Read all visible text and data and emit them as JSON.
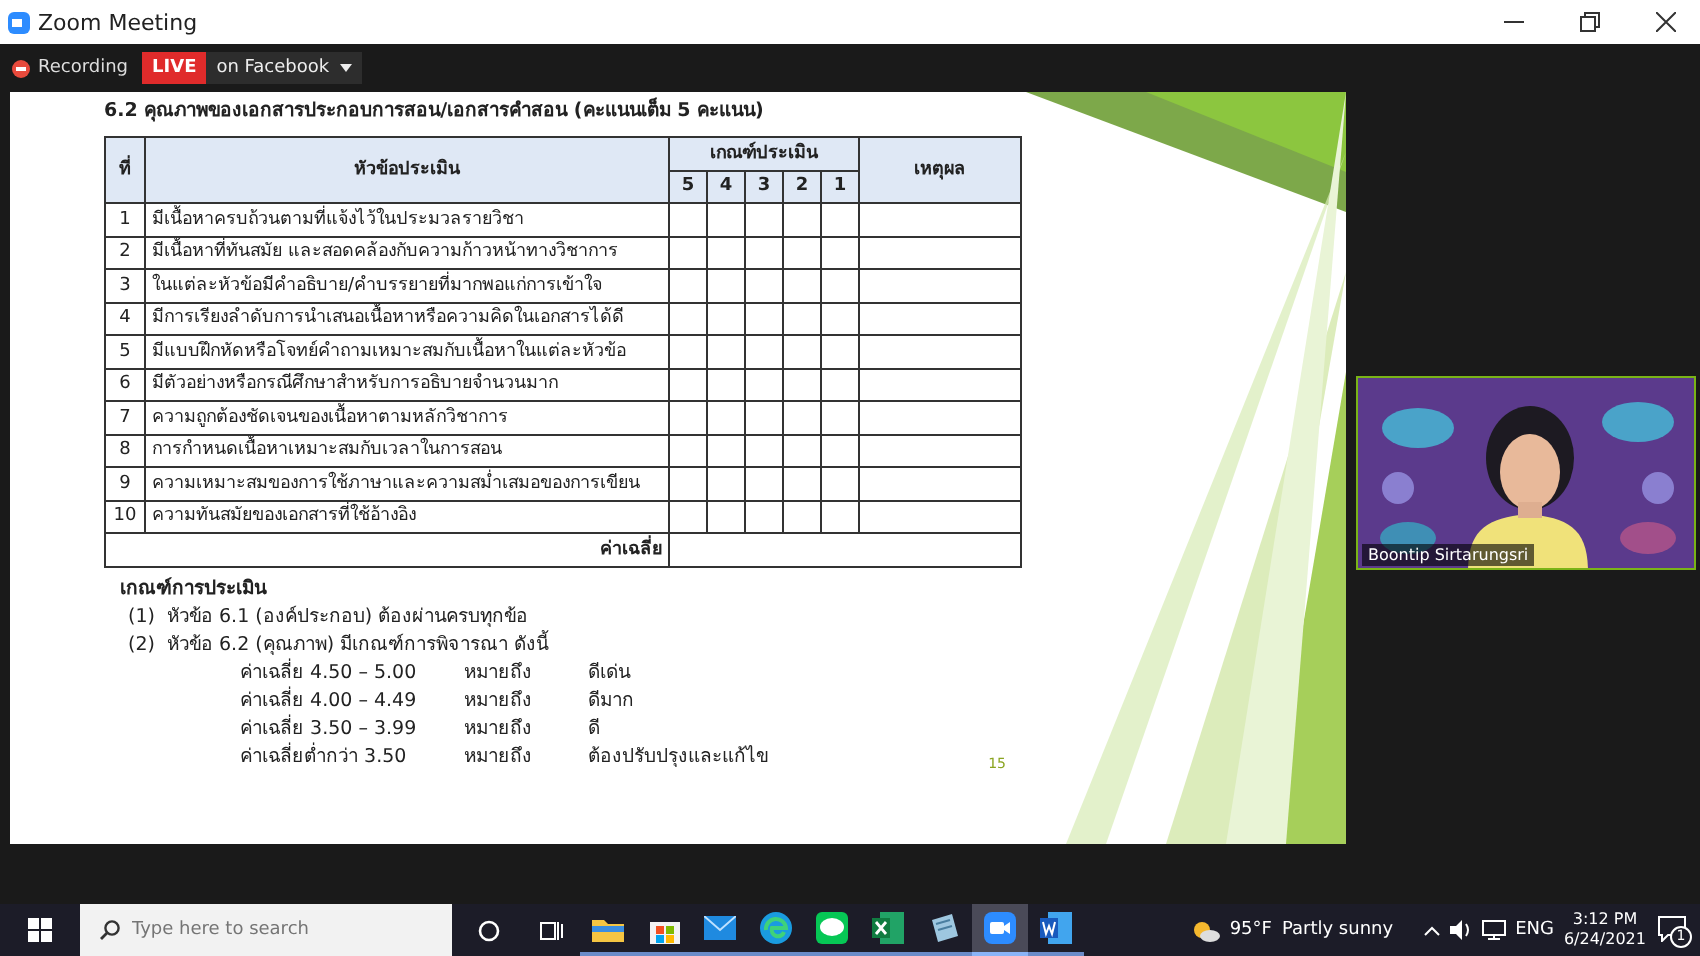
{
  "window": {
    "title": "Zoom Meeting"
  },
  "meeting_bar": {
    "recording": "Recording",
    "live_badge": "LIVE",
    "live_target": "on Facebook"
  },
  "slide": {
    "heading": "6.2 คุณภาพของเอกสารประกอบการสอน/เอกสารคำสอน (คะแนนเต็ม 5 คะแนน)",
    "table": {
      "columns": {
        "number": "ที่",
        "topic": "หัวข้อประเมิน",
        "criteria": "เกณฑ์ประเมิน",
        "scores": [
          "5",
          "4",
          "3",
          "2",
          "1"
        ],
        "reason": "เหตุผล"
      },
      "rows": [
        {
          "number": "1",
          "topic": "มีเนื้อหาครบถ้วนตามที่แจ้งไว้ในประมวลรายวิชา"
        },
        {
          "number": "2",
          "topic": "มีเนื้อหาที่ทันสมัย และสอดคล้องกับความก้าวหน้าทางวิชาการ"
        },
        {
          "number": "3",
          "topic": "ในแต่ละหัวข้อมีคำอธิบาย/คำบรรยายที่มากพอแก่การเข้าใจ"
        },
        {
          "number": "4",
          "topic": "มีการเรียงลำดับการนำเสนอเนื้อหาหรือความคิดในเอกสารได้ดี"
        },
        {
          "number": "5",
          "topic": "มีแบบฝึกหัดหรือโจทย์คำถามเหมาะสมกับเนื้อหาในแต่ละหัวข้อ"
        },
        {
          "number": "6",
          "topic": "มีตัวอย่างหรือกรณีศึกษาสำหรับการอธิบายจำนวนมาก"
        },
        {
          "number": "7",
          "topic": "ความถูกต้องชัดเจนของเนื้อหาตามหลักวิชาการ"
        },
        {
          "number": "8",
          "topic": "การกำหนดเนื้อหาเหมาะสมกับเวลาในการสอน"
        },
        {
          "number": "9",
          "topic": "ความเหมาะสมของการใช้ภาษาและความสม่ำเสมอของการเขียน"
        },
        {
          "number": "10",
          "topic": "ความทันสมัยของเอกสารที่ใช้อ้างอิง"
        }
      ],
      "average_label": "ค่าเฉลี่ย"
    },
    "criteria": {
      "title": "เกณฑ์การประเมิน",
      "items": [
        "(1)  หัวข้อ 6.1 (องค์ประกอบ) ต้องผ่านครบทุกข้อ",
        "(2)  หัวข้อ 6.2 (คุณภาพ) มีเกณฑ์การพิจารณา ดังนี้"
      ],
      "ranges": [
        {
          "range": "ค่าเฉลี่ย 4.50 – 5.00",
          "means": "หมายถึง",
          "result": "ดีเด่น"
        },
        {
          "range": "ค่าเฉลี่ย 4.00 – 4.49",
          "means": "หมายถึง",
          "result": "ดีมาก"
        },
        {
          "range": "ค่าเฉลี่ย 3.50 – 3.99",
          "means": "หมายถึง",
          "result": "ดี"
        },
        {
          "range": "ค่าเฉลี่ยต่ำกว่า 3.50",
          "means": "หมายถึง",
          "result": "ต้องปรับปรุงและแก้ไข"
        }
      ]
    },
    "page_number": "15"
  },
  "video": {
    "name": "Boontip Sirtarungsri"
  },
  "taskbar": {
    "search_placeholder": "Type here to search",
    "apps": [
      {
        "kind": "explorer",
        "selected": false
      },
      {
        "kind": "store",
        "selected": false
      },
      {
        "kind": "mail",
        "selected": false
      },
      {
        "kind": "edge",
        "selected": false
      },
      {
        "kind": "line",
        "selected": false
      },
      {
        "kind": "excel",
        "selected": false
      },
      {
        "kind": "notes",
        "selected": false
      },
      {
        "kind": "zoom",
        "selected": true
      },
      {
        "kind": "word",
        "selected": false
      }
    ],
    "weather": "95°F",
    "weather_text": "Partly sunny",
    "language": "ENG",
    "time": "3:12 PM",
    "date": "6/24/2021",
    "notifications": "1"
  }
}
